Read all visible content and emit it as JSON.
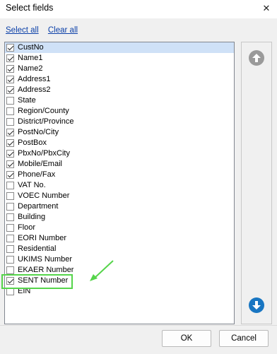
{
  "window": {
    "title": "Select fields",
    "close_glyph": "✕"
  },
  "links": {
    "select_all": "Select all",
    "clear_all": "Clear all"
  },
  "fields": [
    {
      "label": "CustNo",
      "checked": true,
      "selected": true
    },
    {
      "label": "Name1",
      "checked": true
    },
    {
      "label": "Name2",
      "checked": true
    },
    {
      "label": "Address1",
      "checked": true
    },
    {
      "label": "Address2",
      "checked": true
    },
    {
      "label": "State",
      "checked": false
    },
    {
      "label": "Region/County",
      "checked": false
    },
    {
      "label": "District/Province",
      "checked": false
    },
    {
      "label": "PostNo/City",
      "checked": true
    },
    {
      "label": "PostBox",
      "checked": true
    },
    {
      "label": "PbxNo/PbxCity",
      "checked": true
    },
    {
      "label": "Mobile/Email",
      "checked": true
    },
    {
      "label": "Phone/Fax",
      "checked": true
    },
    {
      "label": "VAT No.",
      "checked": false
    },
    {
      "label": "VOEC Number",
      "checked": false
    },
    {
      "label": "Department",
      "checked": false
    },
    {
      "label": "Building",
      "checked": false
    },
    {
      "label": "Floor",
      "checked": false
    },
    {
      "label": "EORI Number",
      "checked": false
    },
    {
      "label": "Residential",
      "checked": false
    },
    {
      "label": "UKIMS Number",
      "checked": false
    },
    {
      "label": "EKAER Number",
      "checked": false
    },
    {
      "label": "SENT Number",
      "checked": true
    },
    {
      "label": "EIN",
      "checked": false
    }
  ],
  "buttons": {
    "ok": "OK",
    "cancel": "Cancel"
  },
  "icons": {
    "move_up": "arrow-up-icon",
    "move_down": "arrow-down-icon",
    "annotation": "arrow-icon"
  },
  "colors": {
    "highlight": "#55d44a",
    "up_button": "#9a9a9a",
    "down_button": "#1976c2",
    "selection": "#cfe1f7",
    "link": "#0a3fa8"
  }
}
